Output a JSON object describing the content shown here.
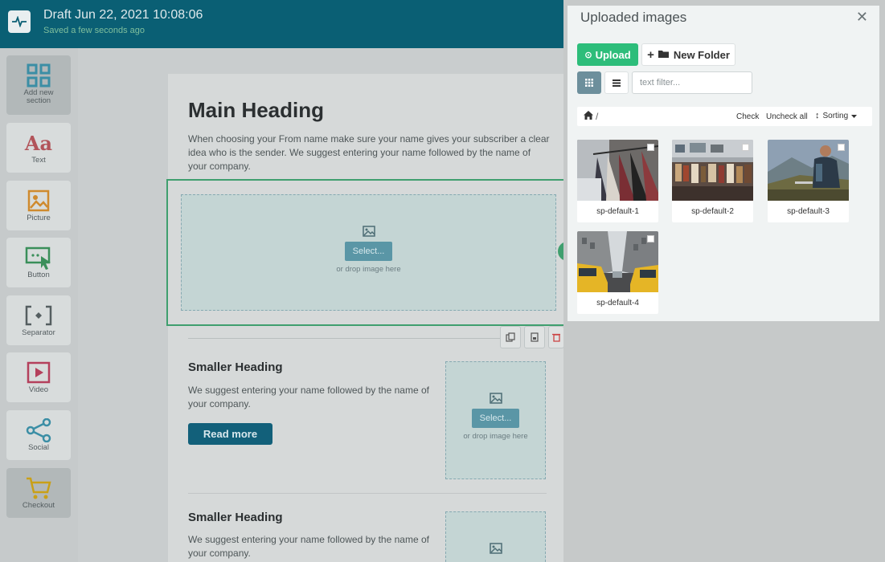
{
  "header": {
    "title": "Draft Jun 22, 2021 10:08:06",
    "subtitle": "Saved a few seconds ago"
  },
  "sidebar": {
    "items": [
      {
        "label": "Add new section",
        "icon": "grid-icon"
      },
      {
        "label": "Text",
        "icon": "text-icon"
      },
      {
        "label": "Picture",
        "icon": "picture-icon"
      },
      {
        "label": "Button",
        "icon": "button-icon"
      },
      {
        "label": "Separator",
        "icon": "separator-icon"
      },
      {
        "label": "Video",
        "icon": "video-icon"
      },
      {
        "label": "Social",
        "icon": "share-icon"
      },
      {
        "label": "Checkout",
        "icon": "cart-icon"
      }
    ]
  },
  "editor": {
    "main_heading": "Main Heading",
    "main_paragraph": "When choosing your From name make sure your name gives your subscriber a clear idea who is the sender. We suggest entering your name followed by the name of your company.",
    "select_button": "Select...",
    "drop_hint": "or drop image here",
    "sections": [
      {
        "heading": "Smaller Heading",
        "paragraph": "We suggest entering your name followed by the name of your company.",
        "button": "Read more"
      },
      {
        "heading": "Smaller Heading",
        "paragraph": "We suggest entering your name followed by the name of your company."
      }
    ]
  },
  "panel": {
    "title": "Uploaded images",
    "upload_label": "Upload",
    "new_folder_label": "New Folder",
    "filter_placeholder": "text filter...",
    "breadcrumb_sep": "/",
    "check_label": "Check",
    "uncheck_all_label": "Uncheck all",
    "sorting_label": "Sorting",
    "images": [
      {
        "name": "sp-default-1"
      },
      {
        "name": "sp-default-2"
      },
      {
        "name": "sp-default-3"
      },
      {
        "name": "sp-default-4"
      }
    ]
  },
  "colors": {
    "topbar": "#0a5f74",
    "upload_green": "#2dbd7a",
    "selection_green": "#3f9f6e",
    "read_more": "#12607a"
  }
}
